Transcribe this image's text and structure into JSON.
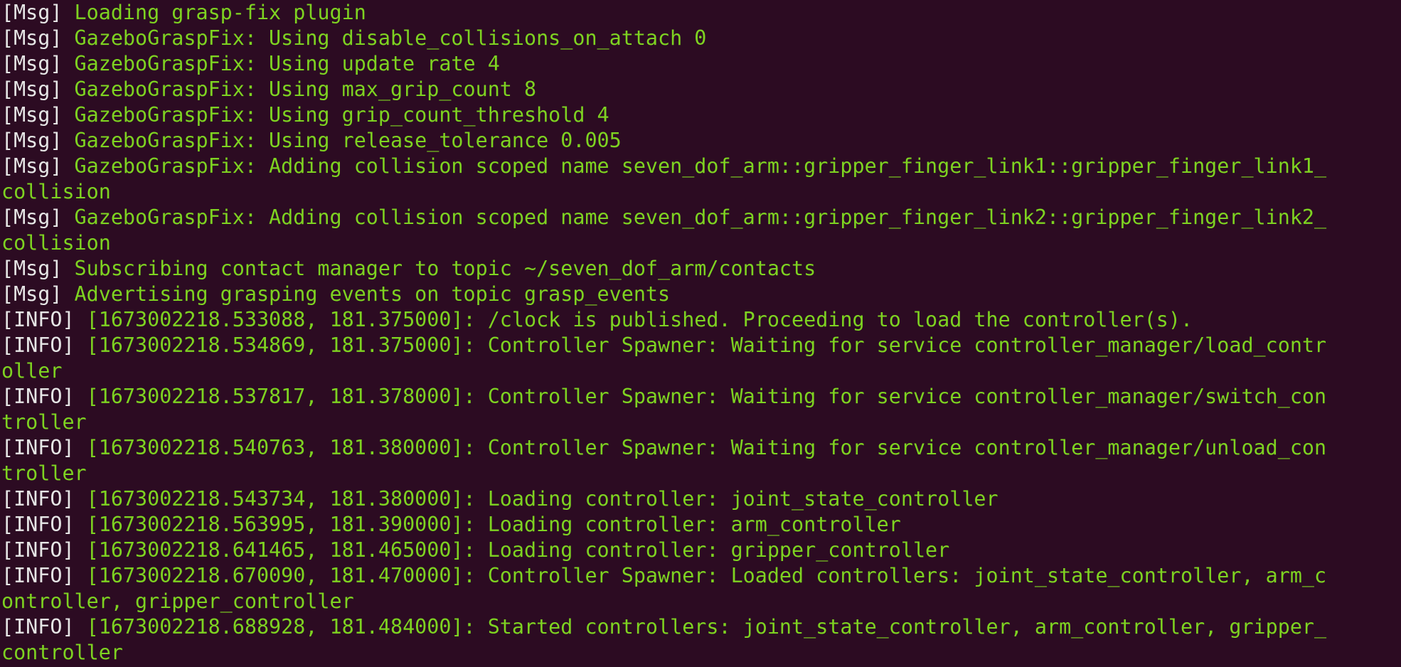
{
  "terminal": {
    "colors": {
      "background": "#2c0b22",
      "prefix": "#e6e6e6",
      "text": "#7ed321"
    },
    "lines": [
      {
        "prefix": "[Msg]",
        "text": " Loading grasp-fix plugin"
      },
      {
        "prefix": "[Msg]",
        "text": " GazeboGraspFix: Using disable_collisions_on_attach 0"
      },
      {
        "prefix": "[Msg]",
        "text": " GazeboGraspFix: Using update rate 4"
      },
      {
        "prefix": "[Msg]",
        "text": " GazeboGraspFix: Using max_grip_count 8"
      },
      {
        "prefix": "[Msg]",
        "text": " GazeboGraspFix: Using grip_count_threshold 4"
      },
      {
        "prefix": "[Msg]",
        "text": " GazeboGraspFix: Using release_tolerance 0.005"
      },
      {
        "prefix": "[Msg]",
        "text": " GazeboGraspFix: Adding collision scoped name seven_dof_arm::gripper_finger_link1::gripper_finger_link1_"
      },
      {
        "prefix": "",
        "text": "collision"
      },
      {
        "prefix": "[Msg]",
        "text": " GazeboGraspFix: Adding collision scoped name seven_dof_arm::gripper_finger_link2::gripper_finger_link2_"
      },
      {
        "prefix": "",
        "text": "collision"
      },
      {
        "prefix": "[Msg]",
        "text": " Subscribing contact manager to topic ~/seven_dof_arm/contacts"
      },
      {
        "prefix": "[Msg]",
        "text": " Advertising grasping events on topic grasp_events"
      },
      {
        "prefix": "[INFO]",
        "text": " [1673002218.533088, 181.375000]: /clock is published. Proceeding to load the controller(s)."
      },
      {
        "prefix": "[INFO]",
        "text": " [1673002218.534869, 181.375000]: Controller Spawner: Waiting for service controller_manager/load_contr"
      },
      {
        "prefix": "",
        "text": "oller"
      },
      {
        "prefix": "[INFO]",
        "text": " [1673002218.537817, 181.378000]: Controller Spawner: Waiting for service controller_manager/switch_con"
      },
      {
        "prefix": "",
        "text": "troller"
      },
      {
        "prefix": "[INFO]",
        "text": " [1673002218.540763, 181.380000]: Controller Spawner: Waiting for service controller_manager/unload_con"
      },
      {
        "prefix": "",
        "text": "troller"
      },
      {
        "prefix": "[INFO]",
        "text": " [1673002218.543734, 181.380000]: Loading controller: joint_state_controller"
      },
      {
        "prefix": "[INFO]",
        "text": " [1673002218.563995, 181.390000]: Loading controller: arm_controller"
      },
      {
        "prefix": "[INFO]",
        "text": " [1673002218.641465, 181.465000]: Loading controller: gripper_controller"
      },
      {
        "prefix": "[INFO]",
        "text": " [1673002218.670090, 181.470000]: Controller Spawner: Loaded controllers: joint_state_controller, arm_c"
      },
      {
        "prefix": "",
        "text": "ontroller, gripper_controller"
      },
      {
        "prefix": "[INFO]",
        "text": " [1673002218.688928, 181.484000]: Started controllers: joint_state_controller, arm_controller, gripper_"
      },
      {
        "prefix": "",
        "text": "controller"
      }
    ]
  }
}
